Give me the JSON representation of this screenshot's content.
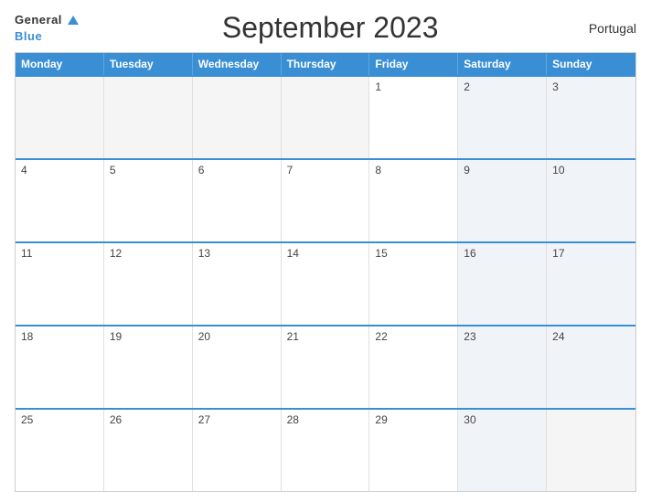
{
  "header": {
    "logo_general": "General",
    "logo_blue": "Blue",
    "title": "September 2023",
    "country": "Portugal"
  },
  "days": [
    "Monday",
    "Tuesday",
    "Wednesday",
    "Thursday",
    "Friday",
    "Saturday",
    "Sunday"
  ],
  "weeks": [
    [
      "",
      "",
      "",
      "",
      "1",
      "2",
      "3"
    ],
    [
      "4",
      "5",
      "6",
      "7",
      "8",
      "9",
      "10"
    ],
    [
      "11",
      "12",
      "13",
      "14",
      "15",
      "16",
      "17"
    ],
    [
      "18",
      "19",
      "20",
      "21",
      "22",
      "23",
      "24"
    ],
    [
      "25",
      "26",
      "27",
      "28",
      "29",
      "30",
      ""
    ]
  ]
}
